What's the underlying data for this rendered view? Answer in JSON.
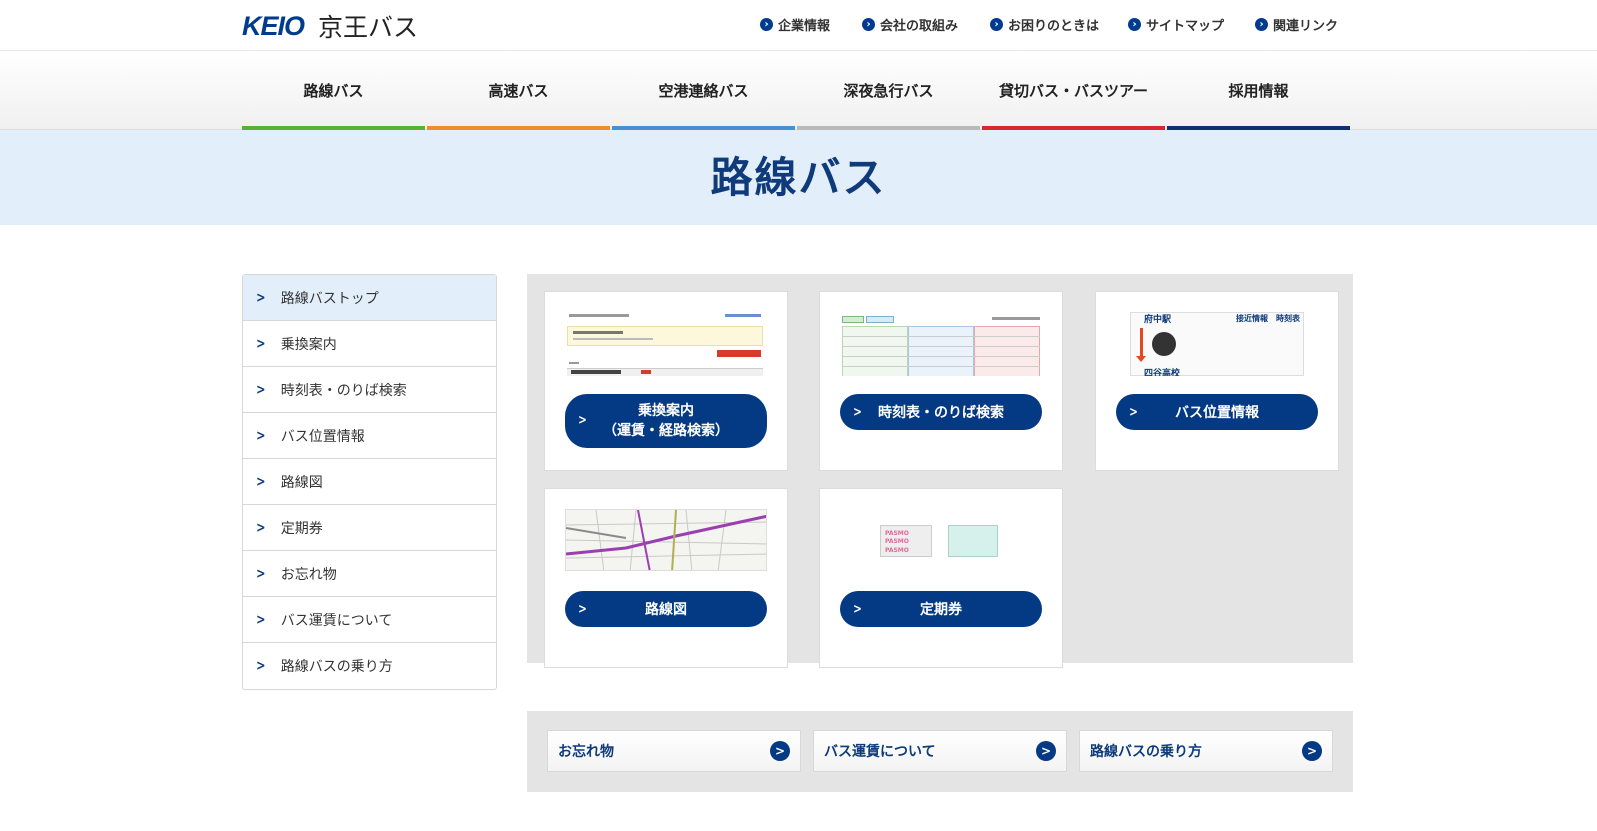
{
  "header": {
    "logo_keio": "KEIO",
    "logo_name": "京王バス",
    "utility_links": [
      "企業情報",
      "会社の取組み",
      "お困りのときは",
      "サイトマップ",
      "関連リンク"
    ]
  },
  "gnav": [
    {
      "label": "路線バス",
      "color": "#5ab033"
    },
    {
      "label": "高速バス",
      "color": "#f08c2e"
    },
    {
      "label": "空港連絡バス",
      "color": "#4a8fd1"
    },
    {
      "label": "深夜急行バス",
      "color": "#b9b9b9"
    },
    {
      "label": "貸切バス・バスツアー",
      "color": "#d8282c"
    },
    {
      "label": "採用情報",
      "color": "#0f2f6e"
    }
  ],
  "page_title": "路線バス",
  "sidebar": {
    "items": [
      {
        "label": "路線バストップ"
      },
      {
        "label": "乗換案内"
      },
      {
        "label": "時刻表・のりば検索"
      },
      {
        "label": "バス位置情報"
      },
      {
        "label": "路線図"
      },
      {
        "label": "定期券"
      },
      {
        "label": "お忘れ物"
      },
      {
        "label": "バス運賃について"
      },
      {
        "label": "路線バスの乗り方"
      }
    ]
  },
  "cards": {
    "transfer": {
      "line1": "乗換案内",
      "line2": "（運賃・経路検索）"
    },
    "timetable": {
      "label": "時刻表・のりば検索"
    },
    "location": {
      "label": "バス位置情報",
      "station_top": "府中駅",
      "station_bottom": "四谷高校",
      "nearby": "接近情報",
      "timetable": "時刻表"
    },
    "map": {
      "label": "路線図"
    },
    "pass": {
      "label": "定期券",
      "pasmo": "PASMO"
    }
  },
  "bottom_links": [
    "お忘れ物",
    "バス運賃について",
    "路線バスの乗り方"
  ],
  "colors": {
    "brand": "#003b8e",
    "pill": "#043984",
    "band": "#e2eefa"
  }
}
